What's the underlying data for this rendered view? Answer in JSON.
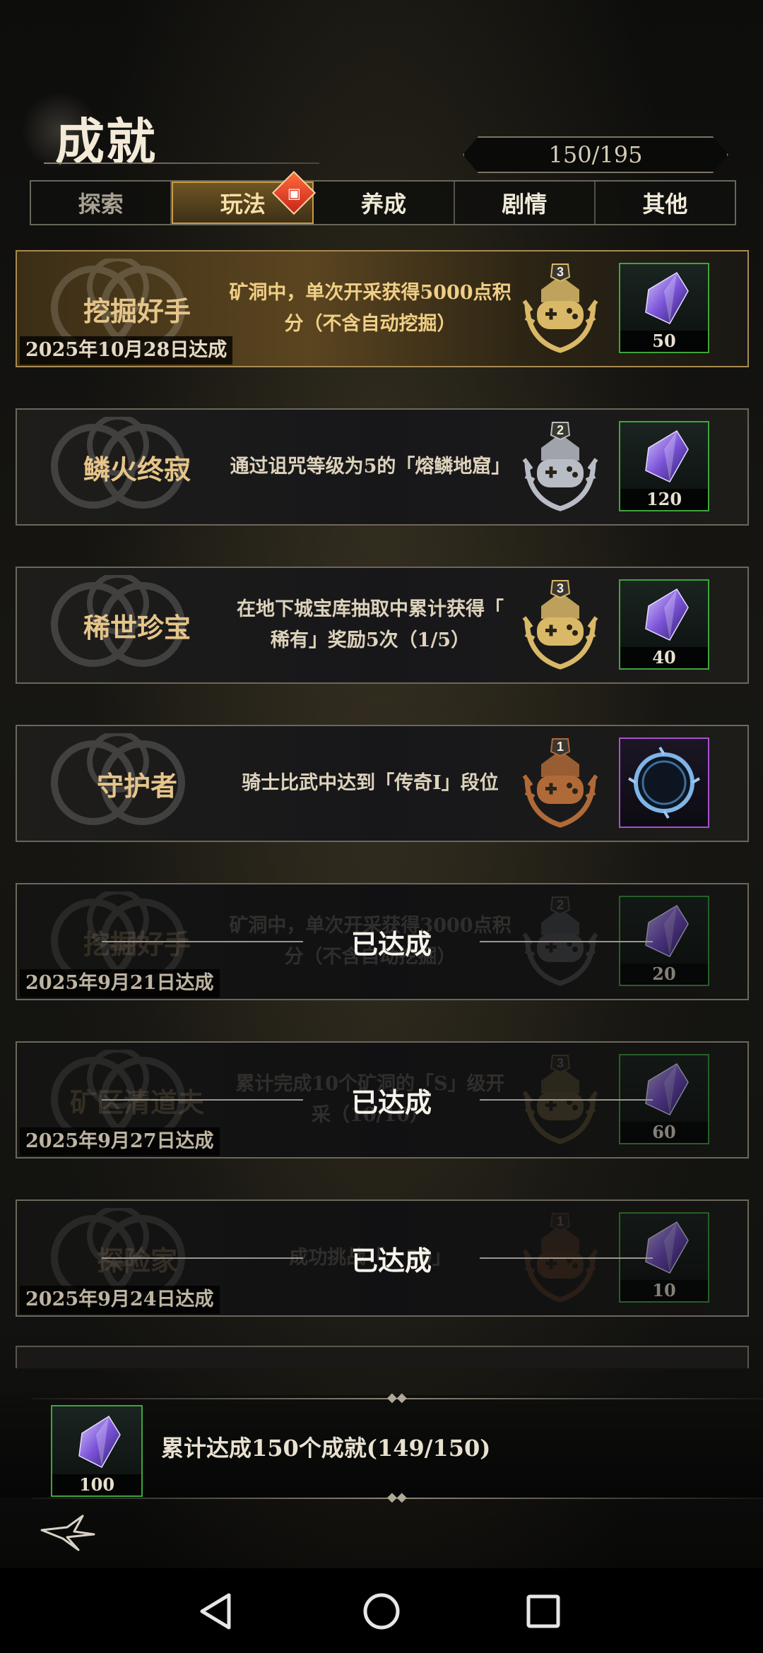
{
  "header": {
    "title": "成就",
    "progress": "150/195"
  },
  "tabs": [
    {
      "label": "探索",
      "state": "inactive"
    },
    {
      "label": "玩法",
      "state": "active",
      "badge": "gift-icon"
    },
    {
      "label": "养成",
      "state": "normal"
    },
    {
      "label": "剧情",
      "state": "normal"
    },
    {
      "label": "其他",
      "state": "normal"
    }
  ],
  "achievements": [
    {
      "name": "挖掘好手",
      "desc_line1": "矿洞中，单次开采获得5000点积",
      "desc_line2": "分（不含自动挖掘）",
      "badge_level": "3",
      "badge_color": "gold",
      "reward_icon": "purple-crystal-icon",
      "reward_count": "50",
      "date": "2025年10月28日达成",
      "status": "highlight"
    },
    {
      "name": "鳞火终寂",
      "desc_line1": "通过诅咒等级为5的「熔鳞地窟」",
      "desc_line2": "",
      "badge_level": "2",
      "badge_color": "silver",
      "reward_icon": "purple-crystal-icon",
      "reward_count": "120",
      "date": "",
      "status": "normal"
    },
    {
      "name": "稀世珍宝",
      "desc_line1": "在地下城宝库抽取中累计获得「",
      "desc_line2": "稀有」奖励5次（1/5）",
      "badge_level": "3",
      "badge_color": "gold",
      "reward_icon": "purple-crystal-icon",
      "reward_count": "40",
      "date": "",
      "status": "normal"
    },
    {
      "name": "守护者",
      "desc_line1": "骑士比武中达到「传奇Ⅰ」段位",
      "desc_line2": "",
      "badge_level": "1",
      "badge_color": "bronze",
      "reward_icon": "frame-icon",
      "reward_count": "",
      "date": "",
      "status": "normal"
    },
    {
      "name": "挖掘好手",
      "desc_line1": "矿洞中，单次开采获得3000点积",
      "desc_line2": "分（不含自动挖掘）",
      "badge_level": "2",
      "badge_color": "silver",
      "reward_icon": "purple-crystal-icon",
      "reward_count": "20",
      "date": "2025年9月21日达成",
      "status": "done"
    },
    {
      "name": "矿区清道夫",
      "desc_line1": "累计完成10个矿洞的「S」级开",
      "desc_line2": "采（10/10）",
      "badge_level": "3",
      "badge_color": "gold",
      "reward_icon": "purple-crystal-icon",
      "reward_count": "60",
      "date": "2025年9月27日达成",
      "status": "done"
    },
    {
      "name": "探险家",
      "desc_line1": "成功挑战「 - 50」",
      "desc_line2": "",
      "badge_level": "1",
      "badge_color": "bronze",
      "reward_icon": "purple-crystal-icon",
      "reward_count": "10",
      "date": "2025年9月24日达成",
      "status": "done"
    }
  ],
  "done_label": "已达成",
  "footer": {
    "reward_count": "100",
    "text": "累计达成150个成就(149/150)"
  },
  "colors": {
    "gold": "#d9b867",
    "silver": "#b8bcc4",
    "bronze": "#b06a38",
    "reward_green": "#3ea53c",
    "reward_purple": "#a94fd1"
  }
}
